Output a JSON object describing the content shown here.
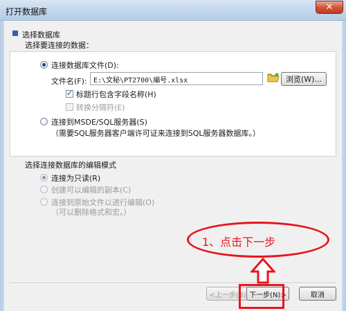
{
  "window": {
    "title": "打开数据库",
    "close_glyph": "✕"
  },
  "section1": {
    "title": "选择数据库",
    "subtitle": "选择要连接的数据："
  },
  "option_file": {
    "label": "连接数据库文件(D):",
    "checked": true
  },
  "filename": {
    "label": "文件名(F):",
    "value": "E:\\文秘\\PT2700\\编号.xlsx"
  },
  "browse_button": {
    "label": "浏览(W)..."
  },
  "checkbox_header": {
    "label": "标题行包含字段名称(H)",
    "checked": true
  },
  "checkbox_delimiter": {
    "label": "转换分隔符(E)",
    "checked": false,
    "disabled": true
  },
  "option_sql": {
    "label": "连接到MSDE/SQL服务器(S)",
    "note": "（需要SQL服务器客户端许可证来连接到SQL服务器数据库。）",
    "checked": false
  },
  "section2": {
    "title": "选择连接数据库的编辑模式"
  },
  "mode_options": [
    {
      "label": "连接为只读(R)",
      "checked": true,
      "disabled": true
    },
    {
      "label": "创建可以编辑的副本(C)",
      "checked": false,
      "disabled": true
    },
    {
      "label": "连接到原始文件以进行编辑(O)",
      "checked": false,
      "disabled": true,
      "note": "（可以删除格式和宏。）"
    }
  ],
  "buttons": {
    "back": "<上一步(B)",
    "next": "下一步(N)>",
    "cancel": "取消"
  },
  "annotation": {
    "text": "1、点击下一步"
  },
  "colors": {
    "annotation_red": "#e8141c",
    "marker_blue": "#3b5ea8"
  },
  "icons": {
    "browse": "folder-icon",
    "annotation_arrow": "arrow-up-icon"
  }
}
